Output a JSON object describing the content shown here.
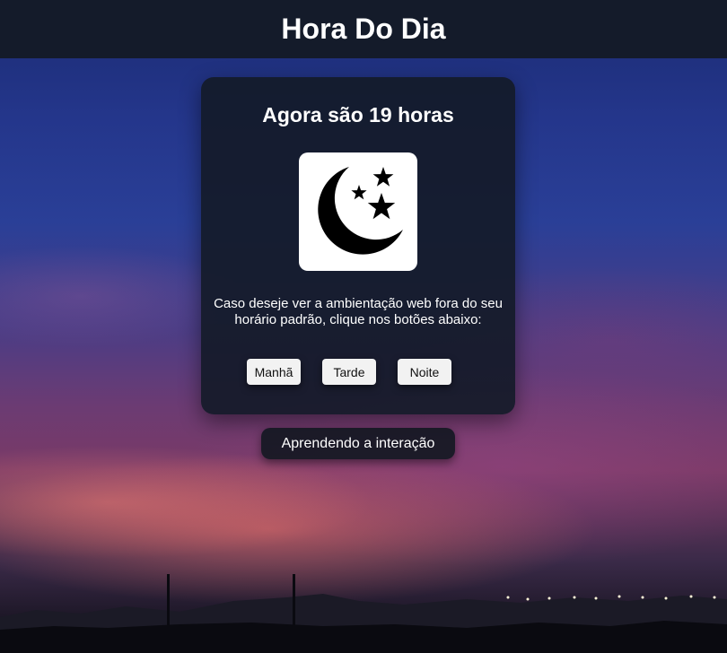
{
  "header": {
    "title": "Hora Do Dia"
  },
  "card": {
    "title": "Agora são 19 horas",
    "image_icon": "moon-stars-icon",
    "description": "Caso deseje ver a ambientação web fora do seu horário padrão, clique nos botões abaixo:",
    "buttons": [
      {
        "label": "Manhã"
      },
      {
        "label": "Tarde"
      },
      {
        "label": "Noite"
      }
    ]
  },
  "learn_button": {
    "label": "Aprendendo a interação"
  },
  "colors": {
    "header_bg": "#141b2a",
    "card_bg": "#141a28",
    "button_bg": "#f2f2f2",
    "text": "#ffffff"
  }
}
